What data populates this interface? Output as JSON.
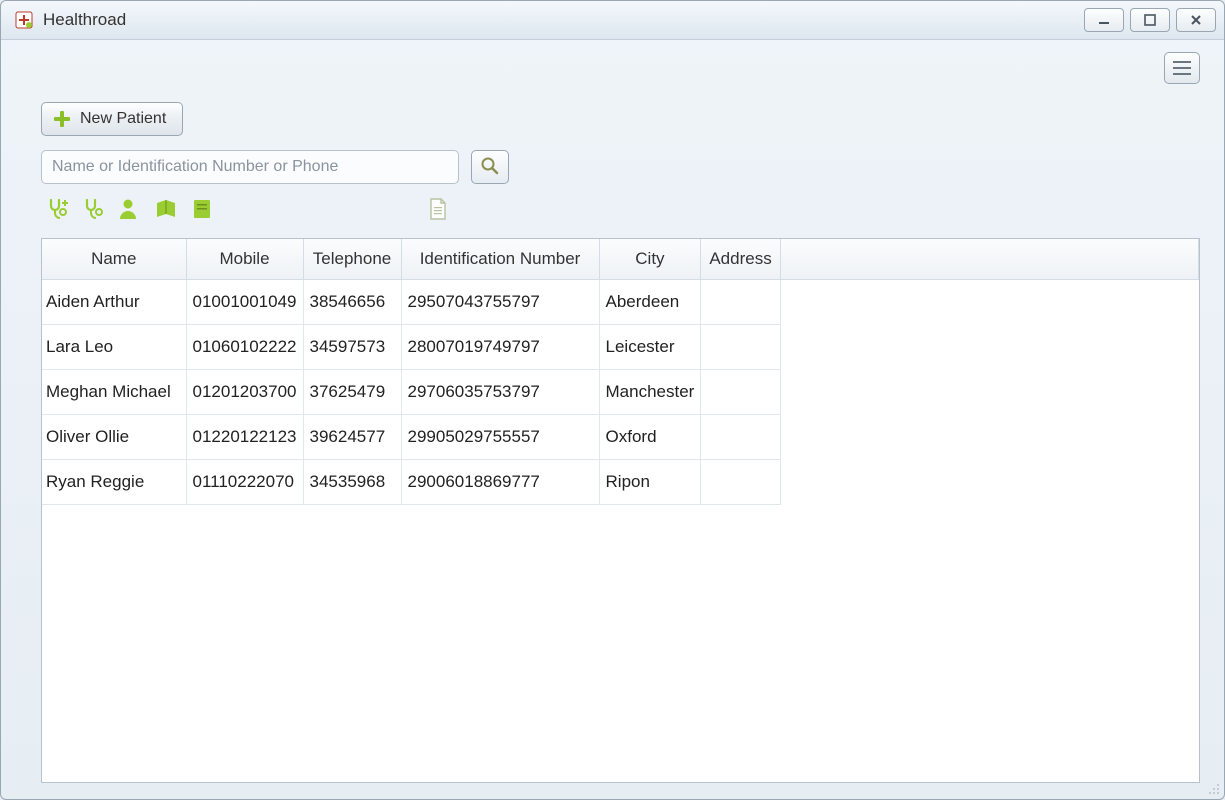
{
  "window": {
    "title": "Healthroad"
  },
  "toolbar": {
    "new_patient_label": "New Patient"
  },
  "search": {
    "placeholder": "Name or Identification Number or Phone",
    "value": ""
  },
  "table": {
    "columns": [
      "Name",
      "Mobile",
      "Telephone",
      "Identification Number",
      "City",
      "Address"
    ],
    "rows": [
      {
        "name": "Aiden Arthur",
        "mobile": "01001001049",
        "telephone": "38546656",
        "idnum": "29507043755797",
        "city": "Aberdeen",
        "address": ""
      },
      {
        "name": "Lara Leo",
        "mobile": "01060102222",
        "telephone": "34597573",
        "idnum": "28007019749797",
        "city": "Leicester",
        "address": ""
      },
      {
        "name": "Meghan Michael",
        "mobile": "01201203700",
        "telephone": "37625479",
        "idnum": "29706035753797",
        "city": "Manchester",
        "address": ""
      },
      {
        "name": "Oliver Ollie",
        "mobile": "01220122123",
        "telephone": "39624577",
        "idnum": "29905029755557",
        "city": "Oxford",
        "address": ""
      },
      {
        "name": "Ryan Reggie",
        "mobile": "01110222070",
        "telephone": "34535968",
        "idnum": "29006018869777",
        "city": "Ripon",
        "address": ""
      }
    ]
  }
}
